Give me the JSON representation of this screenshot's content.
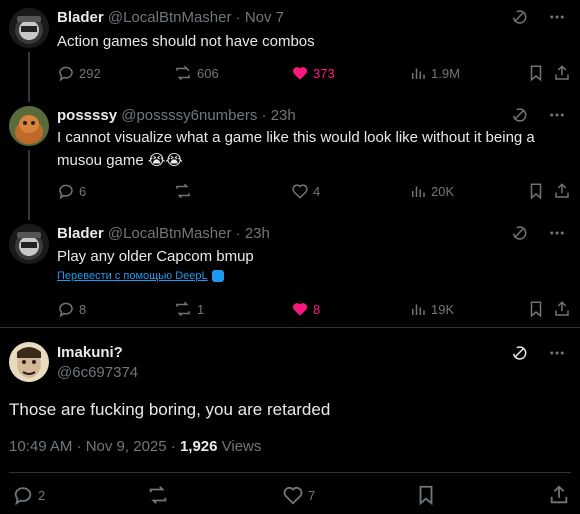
{
  "tweets": [
    {
      "name": "Blader",
      "handle": "@LocalBtnMasher",
      "time": "Nov 7",
      "text": "Action games should not have combos",
      "replies": "292",
      "reposts": "606",
      "likes": "373",
      "views": "1.9M"
    },
    {
      "name": "possssy",
      "handle": "@possssy6numbers",
      "time": "23h",
      "text_line1": "I cannot visualize what a game like this would look like without it being a",
      "text_line2": "musou game 😭😭",
      "replies": "6",
      "reposts": "",
      "likes": "4",
      "views": "20K"
    },
    {
      "name": "Blader",
      "handle": "@LocalBtnMasher",
      "time": "23h",
      "text": "Play any older Capcom bmup",
      "translate_link": "Перевести с помощью DeepL",
      "replies": "8",
      "reposts": "1",
      "likes": "8",
      "views": "19K"
    }
  ],
  "main": {
    "name": "Imakuni?",
    "handle": "@6c697374",
    "text": "Those are fucking boring, you are retarded",
    "timestamp": "10:49 AM · Nov 9, 2025 · ",
    "views_count": "1,926",
    "views_label": " Views",
    "replies": "2",
    "reposts": "",
    "likes": "7"
  },
  "colors": {
    "background": "#000000",
    "text": "#e7e9ea",
    "muted": "#71767b",
    "like_active": "#f91880",
    "link": "#1d9bf0",
    "divider": "#2f3336"
  },
  "icons": [
    "reply-icon",
    "repost-icon",
    "like-icon",
    "views-icon",
    "bookmark-icon",
    "share-icon",
    "grok-icon",
    "more-icon"
  ]
}
